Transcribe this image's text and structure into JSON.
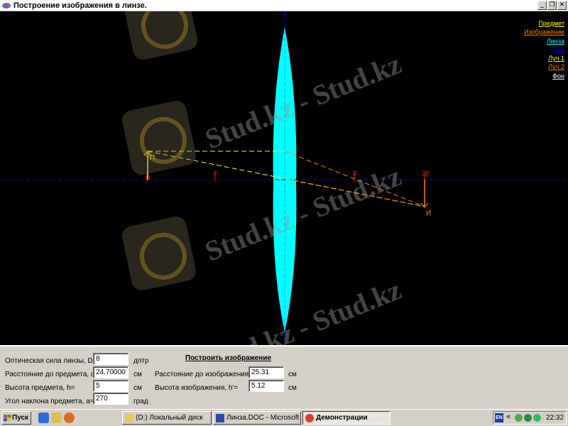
{
  "window": {
    "title": "Построение изображения в линзе.",
    "buttons": [
      "_",
      "❐",
      "✕"
    ]
  },
  "canvas": {
    "background": "#000000",
    "legend": [
      {
        "label": "Предмет",
        "color": "#ffff00"
      },
      {
        "label": "Изображение",
        "color": "#ff8000"
      },
      {
        "label": "Линза",
        "color": "#00ffff"
      },
      {
        "label": "Оси",
        "color": "#0000ff"
      },
      {
        "label": "Луч 1",
        "color": "#ffff00"
      },
      {
        "label": "Луч 2",
        "color": "#ff8000"
      },
      {
        "label": "Фон",
        "color": "#ffffff"
      }
    ],
    "labels": {
      "object": "П",
      "image": "И",
      "focus_left": "F",
      "focus_right": "F",
      "double_focus_left": "F",
      "double_focus_right": "2F"
    },
    "colors": {
      "lens": "#00ffff",
      "axes": "#0000ff",
      "object": "#ffff00",
      "image": "#ff8000",
      "ray1": "#ffff00",
      "ray2": "#ff8000",
      "focus_mark": "#ff0000"
    },
    "watermark_text": "Stud.kz - Stud.kz"
  },
  "panel": {
    "build_button": "Построить изображение",
    "fields": [
      {
        "label": "Оптическая сила линзы, D=",
        "value": "8",
        "unit": "дптр"
      },
      {
        "label": "Расстояние до предмета, d=",
        "value": "24.70000",
        "unit": "см"
      },
      {
        "label": "Высота предмета, h=",
        "value": "5",
        "unit": "см"
      },
      {
        "label": "Угол наклона предмета, a=",
        "value": "270",
        "unit": "град"
      }
    ],
    "results": [
      {
        "label": "Расстояние до изображения, f=",
        "value": "25.31",
        "unit": "см"
      },
      {
        "label": "Высота изображения, h'=",
        "value": "5.12",
        "unit": "см"
      }
    ]
  },
  "taskbar": {
    "start": "Пуск",
    "tasks": [
      {
        "label": "(D:) Локальный диск",
        "active": false
      },
      {
        "label": "Линза.DOC - Microsoft ...",
        "active": false
      },
      {
        "label": "Демонстрации",
        "active": true
      }
    ],
    "lang": "EN",
    "clock": "22:32"
  }
}
